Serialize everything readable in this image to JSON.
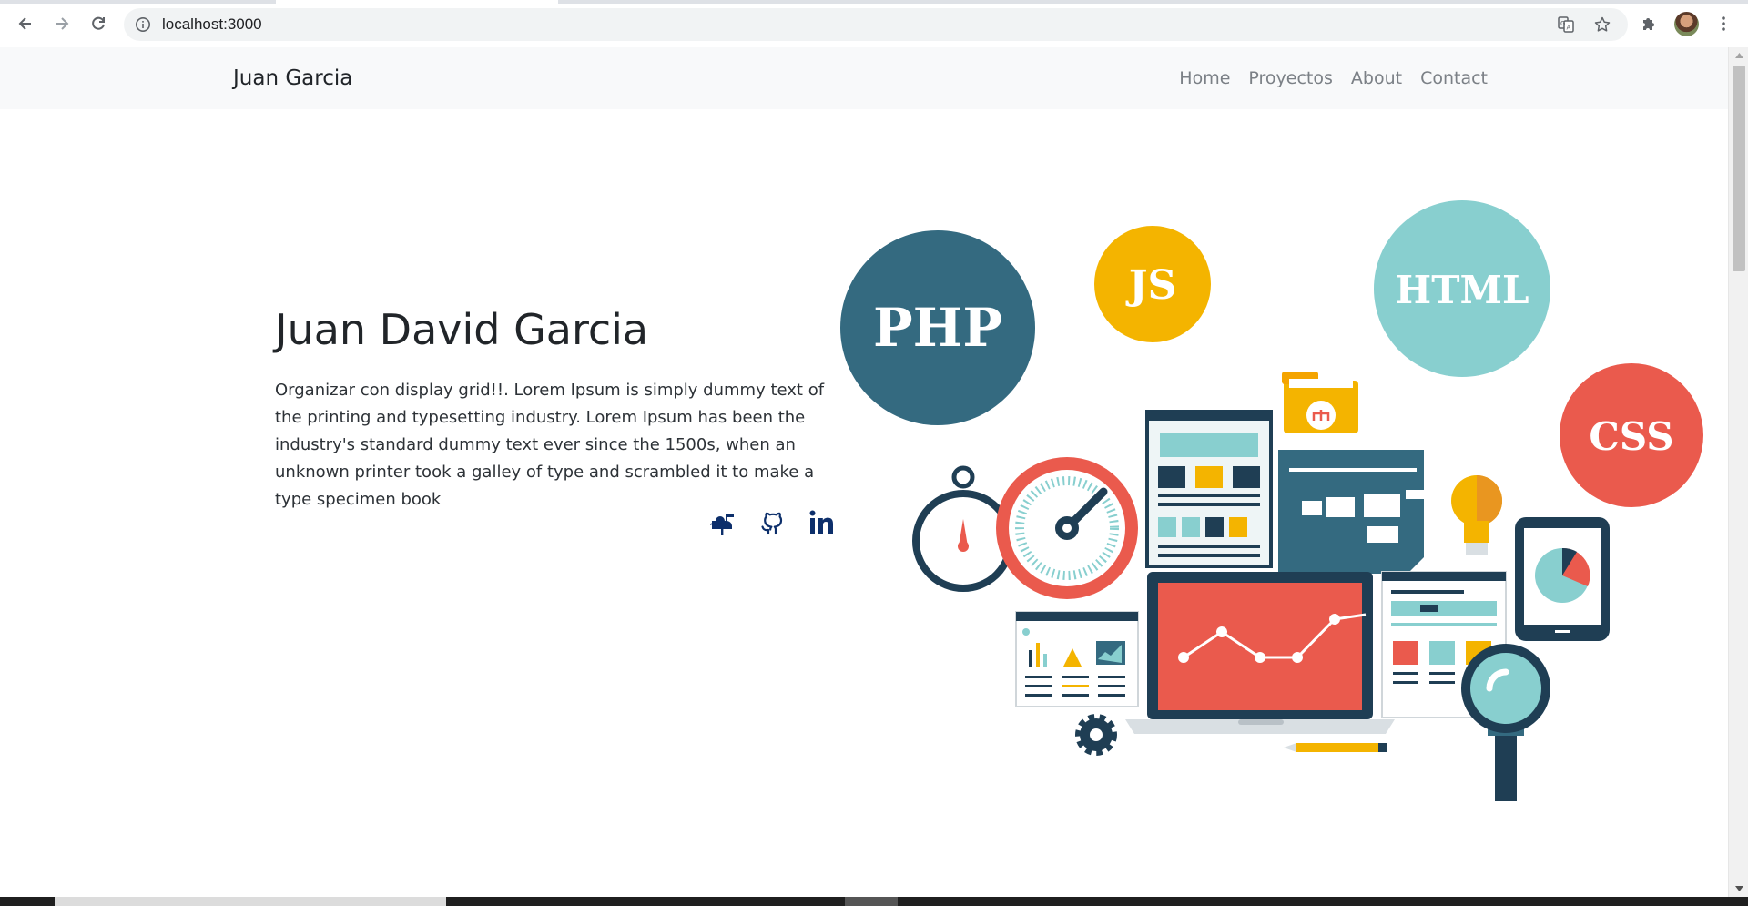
{
  "browser": {
    "url": "localhost:3000",
    "icons": [
      "back-arrow-icon",
      "forward-arrow-icon",
      "reload-icon",
      "info-icon",
      "translate-icon",
      "star-icon",
      "extensions-puzzle-icon",
      "profile-avatar",
      "more-vertical-icon"
    ]
  },
  "site": {
    "brand": "Juan Garcia",
    "nav": [
      {
        "label": "Home"
      },
      {
        "label": "Proyectos"
      },
      {
        "label": "About"
      },
      {
        "label": "Contact"
      }
    ]
  },
  "hero": {
    "title": "Juan David Garcia",
    "description": "Organizar con display grid!!. Lorem Ipsum is simply dummy text of the printing and typesetting industry. Lorem Ipsum has been the industry's standard dummy text ever since the 1500s, when an unknown printer took a galley of type and scrambled it to make a type specimen book",
    "social_icons": [
      "mailbox-icon",
      "github-icon",
      "linkedin-icon"
    ],
    "accent_color": "#0d2f6b"
  },
  "illustration": {
    "bubbles": [
      {
        "label": "PHP",
        "color": "#346a80"
      },
      {
        "label": "JS",
        "color": "#f4b400"
      },
      {
        "label": "HTML",
        "color": "#88cfcf"
      },
      {
        "label": "CSS",
        "color": "#ea5a4d"
      }
    ]
  }
}
